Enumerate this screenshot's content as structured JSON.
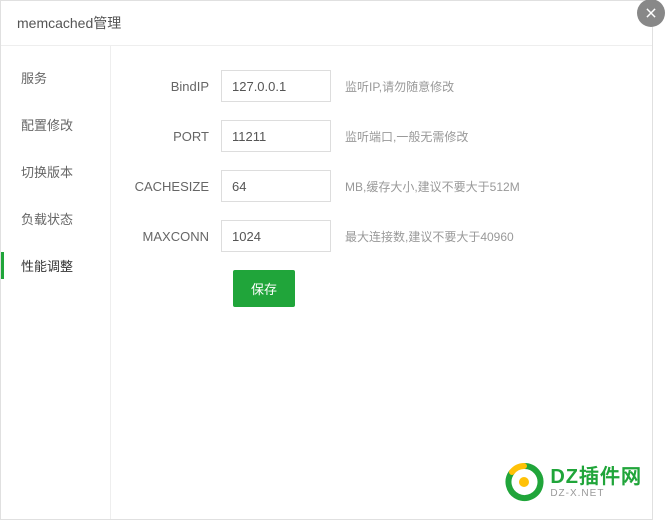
{
  "header": {
    "title": "memcached管理"
  },
  "sidebar": {
    "items": [
      {
        "label": "服务"
      },
      {
        "label": "配置修改"
      },
      {
        "label": "切换版本"
      },
      {
        "label": "负载状态"
      },
      {
        "label": "性能调整"
      }
    ]
  },
  "form": {
    "fields": [
      {
        "label": "BindIP",
        "value": "127.0.0.1",
        "hint": "监听IP,请勿随意修改"
      },
      {
        "label": "PORT",
        "value": "11211",
        "hint": "监听端口,一般无需修改"
      },
      {
        "label": "CACHESIZE",
        "value": "64",
        "hint": "MB,缓存大小,建议不要大于512M"
      },
      {
        "label": "MAXCONN",
        "value": "1024",
        "hint": "最大连接数,建议不要大于40960"
      }
    ],
    "save_label": "保存"
  },
  "watermark": {
    "main": "DZ插件网",
    "sub": "DZ-X.NET"
  }
}
